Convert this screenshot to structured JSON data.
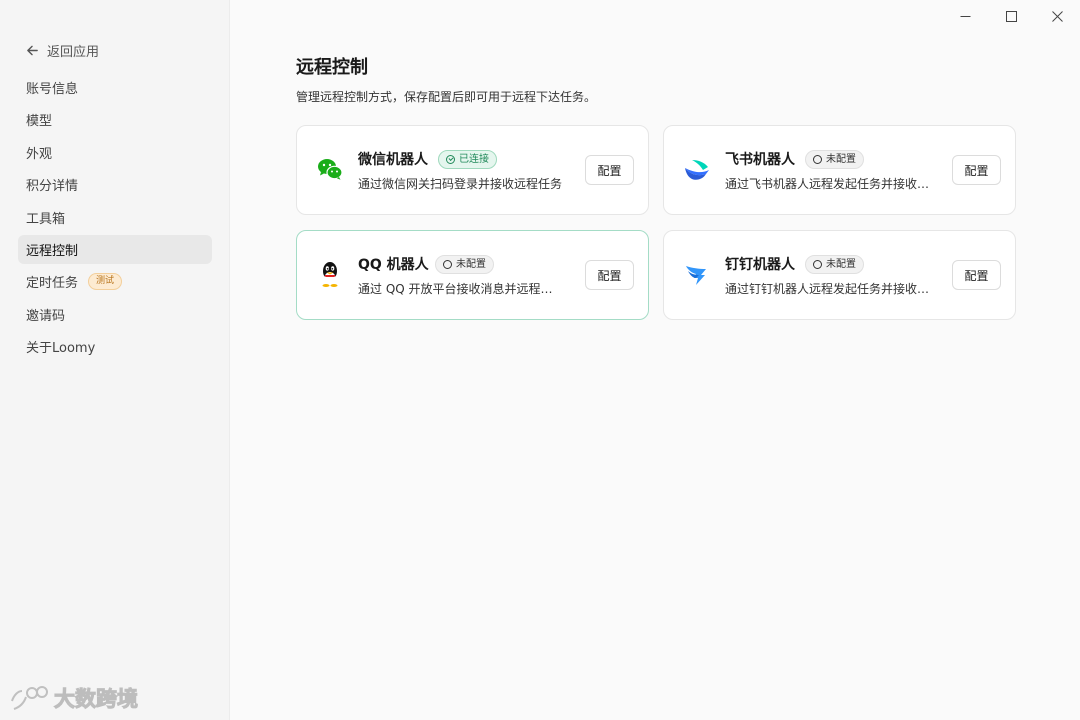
{
  "sidebar": {
    "back_label": "返回应用",
    "items": [
      {
        "label": "账号信息",
        "name": "sidebar-item-account"
      },
      {
        "label": "模型",
        "name": "sidebar-item-model"
      },
      {
        "label": "外观",
        "name": "sidebar-item-appearance"
      },
      {
        "label": "积分详情",
        "name": "sidebar-item-points"
      },
      {
        "label": "工具箱",
        "name": "sidebar-item-toolbox"
      },
      {
        "label": "远程控制",
        "name": "sidebar-item-remote-control",
        "active": true
      },
      {
        "label": "定时任务",
        "name": "sidebar-item-scheduled-tasks",
        "badge": "测试"
      },
      {
        "label": "邀请码",
        "name": "sidebar-item-invite-code"
      },
      {
        "label": "关于Loomy",
        "name": "sidebar-item-about"
      }
    ],
    "watermark": "大数跨境"
  },
  "main": {
    "title": "远程控制",
    "description": "管理远程控制方式，保存配置后即可用于远程下达任务。",
    "cards": [
      {
        "name": "微信机器人",
        "status": "已连接",
        "connected": true,
        "desc": "通过微信网关扫码登录并接收远程任务",
        "button": "配置",
        "icon": "wechat-icon"
      },
      {
        "name": "飞书机器人",
        "status": "未配置",
        "connected": false,
        "desc": "通过飞书机器人远程发起任务并接收结果",
        "button": "配置",
        "icon": "feishu-icon"
      },
      {
        "name": "QQ 机器人",
        "status": "未配置",
        "connected": false,
        "desc": "通过 QQ 开放平台接收消息并远程执行任务",
        "button": "配置",
        "icon": "qq-icon",
        "highlight": true
      },
      {
        "name": "钉钉机器人",
        "status": "未配置",
        "connected": false,
        "desc": "通过钉钉机器人远程发起任务并接收结果",
        "button": "配置",
        "icon": "dingtalk-icon"
      }
    ]
  },
  "colors": {
    "connected_green": "#21895a",
    "sidebar_bg": "#f5f5f5",
    "test_badge": "#b8741c"
  }
}
